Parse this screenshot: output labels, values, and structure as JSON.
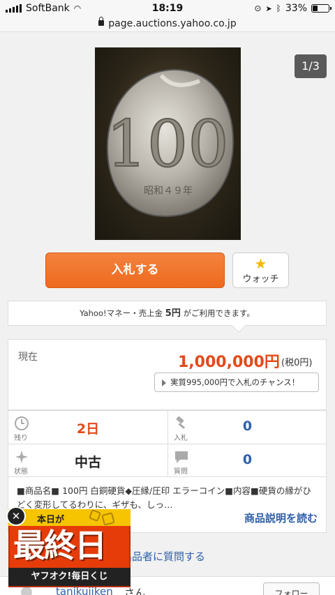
{
  "status_bar": {
    "carrier": "SoftBank",
    "time": "18:19",
    "battery": "33%",
    "battery_level": 0.33
  },
  "url_bar": {
    "url": "page.auctions.yahoo.co.jp"
  },
  "image": {
    "counter": "1/3",
    "coin_text": "100"
  },
  "actions": {
    "bid_label": "入札する",
    "watch_label": "ウォッチ"
  },
  "yahoo_money": {
    "prefix": "Yahoo!マネー・売上金",
    "amount": "5円",
    "suffix": "がご利用できます。"
  },
  "price": {
    "label": "現在",
    "value": "1,000,000円",
    "tax": "(税0円)",
    "chance": "実質995,000円で入札のチャンス！"
  },
  "stats": {
    "remaining_label": "残り",
    "remaining_value": "2日",
    "bids_label": "入札",
    "bids_value": "0",
    "condition_label": "状態",
    "condition_value": "中古",
    "questions_label": "質問",
    "questions_value": "0"
  },
  "description": {
    "text": "■商品名■ 100円 白銅硬貨◆圧縁/圧印 エラーコイン■内容■硬貨の縁がひどく変形してるわりに、ギザも、しっ…",
    "more_label": "商品説明を読む"
  },
  "ask_seller": "出品者に質問する",
  "seller": {
    "name": "tanikujiken",
    "suffix": "さん",
    "follow_label": "フォロー"
  },
  "promo": {
    "top_text": "本日が",
    "big_text": "最終日",
    "bottom_text": "ヤフオク!毎日くじ",
    "close_label": "✕"
  },
  "colors": {
    "accent_orange": "#ed6a1e",
    "price_red": "#e24a1a",
    "link_blue": "#2d5fa8"
  }
}
